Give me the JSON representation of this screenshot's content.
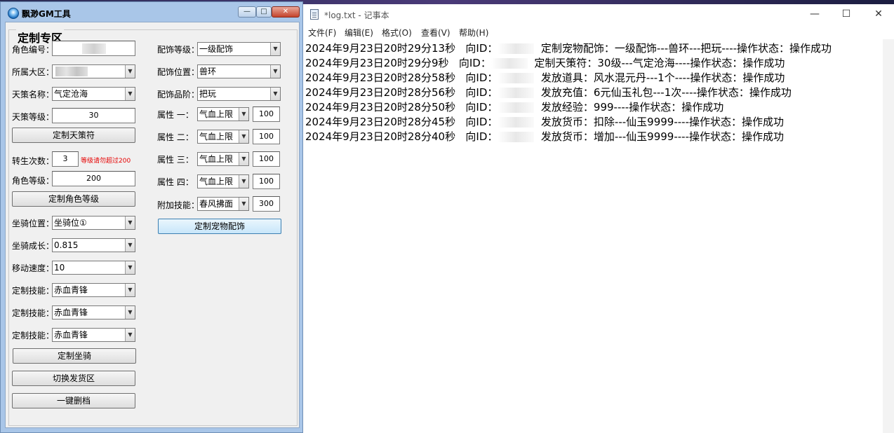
{
  "gm": {
    "title": "飘渺GM工具",
    "group_title": "定制专区",
    "caption_min": "—",
    "caption_max": "□",
    "caption_close": "✕",
    "left": {
      "role_id_label": "角色编号：",
      "role_id_value": "",
      "server_label": "所属大区：",
      "server_value": "",
      "tiance_name_label": "天策名称：",
      "tiance_name_value": "气定沧海",
      "tiance_level_label": "天策等级：",
      "tiance_level_value": "30",
      "tiance_button": "定制天策符",
      "rebirth_label": "转生次数：",
      "rebirth_value": "3",
      "rebirth_warning": "等级请勿超过200",
      "role_level_label": "角色等级：",
      "role_level_value": "200",
      "role_level_button": "定制角色等级",
      "mount_pos_label": "坐骑位置：",
      "mount_pos_value": "坐骑位①",
      "mount_growth_label": "坐骑成长：",
      "mount_growth_value": "0.815",
      "move_speed_label": "移动速度：",
      "move_speed_value": "10",
      "skill_label": "定制技能：",
      "skills": [
        "赤血青锋",
        "赤血青锋",
        "赤血青锋"
      ],
      "mount_button": "定制坐骑",
      "switch_button": "切换发货区",
      "delete_button": "一键删档"
    },
    "right": {
      "acc_level_label": "配饰等级：",
      "acc_level_value": "一级配饰",
      "acc_pos_label": "配饰位置：",
      "acc_pos_value": "兽环",
      "acc_grade_label": "配饰品阶：",
      "acc_grade_value": "把玩",
      "attrs": [
        {
          "label": "属性 一：",
          "value": "气血上限",
          "amount": "100"
        },
        {
          "label": "属性 二：",
          "value": "气血上限",
          "amount": "100"
        },
        {
          "label": "属性 三：",
          "value": "气血上限",
          "amount": "100"
        },
        {
          "label": "属性 四：",
          "value": "气血上限",
          "amount": "100"
        }
      ],
      "extra_skill_label": "附加技能：",
      "extra_skill_value": "春风拂面",
      "extra_skill_amount": "300",
      "pet_acc_button": "定制宠物配饰"
    }
  },
  "notepad": {
    "title": "*log.txt - 记事本",
    "menu": [
      "文件(F)",
      "编辑(E)",
      "格式(O)",
      "查看(V)",
      "帮助(H)"
    ],
    "lines": [
      {
        "time": "2024年9月23日20时29分13秒",
        "to": "向ID：",
        "msg": "定制宠物配饰：一级配饰---兽环---把玩----操作状态：操作成功"
      },
      {
        "time": "2024年9月23日20时29分9秒",
        "to": "向ID：",
        "msg": "定制天策符：30级---气定沧海----操作状态：操作成功"
      },
      {
        "time": "2024年9月23日20时28分58秒",
        "to": "向ID：",
        "msg": "发放道具：风水混元丹---1个----操作状态：操作成功"
      },
      {
        "time": "2024年9月23日20时28分56秒",
        "to": "向ID：",
        "msg": "发放充值：6元仙玉礼包---1次----操作状态：操作成功"
      },
      {
        "time": "2024年9月23日20时28分50秒",
        "to": "向ID：",
        "msg": "发放经验：999----操作状态：操作成功"
      },
      {
        "time": "2024年9月23日20时28分45秒",
        "to": "向ID：",
        "msg": "发放货币：扣除---仙玉9999----操作状态：操作成功"
      },
      {
        "time": "2024年9月23日20时28分40秒",
        "to": "向ID：",
        "msg": "发放货币：增加---仙玉9999----操作状态：操作成功"
      }
    ]
  }
}
